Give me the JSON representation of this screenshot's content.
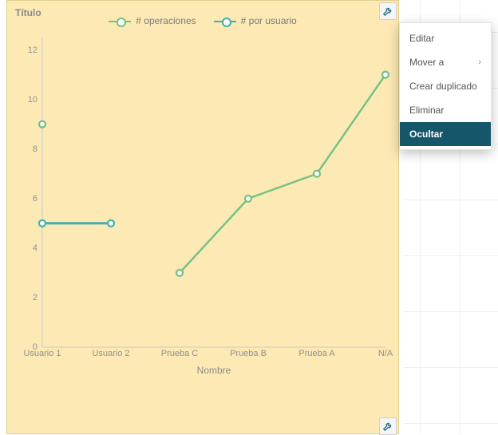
{
  "chart_data": {
    "type": "line",
    "title": "Título",
    "xlabel": "Nombre",
    "ylabel": "",
    "ylim": [
      0,
      12.5
    ],
    "y_ticks": [
      0,
      2,
      4,
      6,
      8,
      10,
      12
    ],
    "categories": [
      "Usuario 1",
      "Usuario 2",
      "Prueba C",
      "Prueba B",
      "Prueba A",
      "N/A"
    ],
    "series": [
      {
        "name": "# operaciones",
        "color": "#72c282",
        "values": [
          9,
          null,
          3,
          6,
          7,
          11
        ]
      },
      {
        "name": "# por usuario",
        "color": "#3fb0ac",
        "values": [
          5,
          5,
          null,
          null,
          null,
          null
        ]
      }
    ]
  },
  "toolbar": {
    "settings_icon": "wrench-icon"
  },
  "context_menu": {
    "items": [
      {
        "label": "Editar",
        "has_submenu": false,
        "selected": false
      },
      {
        "label": "Mover a",
        "has_submenu": true,
        "selected": false
      },
      {
        "label": "Crear duplicado",
        "has_submenu": false,
        "selected": false
      },
      {
        "label": "Eliminar",
        "has_submenu": false,
        "selected": false
      },
      {
        "label": "Ocultar",
        "has_submenu": false,
        "selected": true
      }
    ]
  }
}
